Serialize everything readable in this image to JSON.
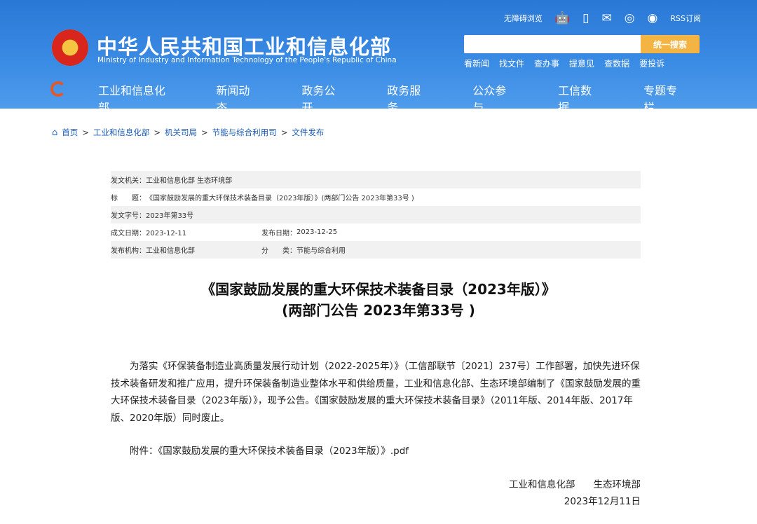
{
  "header": {
    "site_name_cn": "中华人民共和国工业和信息化部",
    "site_name_en": "Ministry of Industry and Information Technology of the People's Republic of China",
    "accessibility": "无障碍浏览",
    "rss": "RSS订阅",
    "search_button": "统一搜索",
    "search_placeholder": "",
    "quick_links": [
      "看新闻",
      "找文件",
      "查办事",
      "提意见",
      "查数据",
      "要投诉"
    ],
    "nav": [
      "工业和信息化部",
      "新闻动态",
      "政务公开",
      "政务服务",
      "公众参与",
      "工信数据",
      "专题专栏"
    ]
  },
  "breadcrumb": [
    "首页",
    "工业和信息化部",
    "机关司局",
    "节能与综合利用司",
    "文件发布"
  ],
  "meta": {
    "issuer_label": "发文机关：",
    "issuer": "工业和信息化部 生态环境部",
    "title_label": "标　　题：",
    "title": "《国家鼓励发展的重大环保技术装备目录（2023年版）》(两部门公告 2023年第33号 )",
    "number_label": "发文字号：",
    "number": "2023年第33号",
    "written_label": "成文日期：",
    "written": "2023-12-11",
    "published_label": "发布日期：",
    "published": "2023-12-25",
    "org_label": "发布机构：",
    "org": "工业和信息化部",
    "category_label": "分　　类：",
    "category": "节能与综合利用"
  },
  "doc": {
    "title_line1": "《国家鼓励发展的重大环保技术装备目录（2023年版）》",
    "title_line2": "(两部门公告 2023年第33号 )",
    "body": "为落实《环保装备制造业高质量发展行动计划（2022-2025年）》（工信部联节〔2021〕237号）工作部署，加快先进环保技术装备研发和推广应用，提升环保装备制造业整体水平和供给质量，工业和信息化部、生态环境部编制了《国家鼓励发展的重大环保技术装备目录（2023年版）》，现予公告。《国家鼓励发展的重大环保技术装备目录》（2011年版、2014年版、2017年版、2020年版）同时废止。",
    "attachment": "附件：《国家鼓励发展的重大环保技术装备目录（2023年版）》.pdf",
    "sign_org1": "工业和信息化部",
    "sign_org2": "生态环境部",
    "sign_date": "2023年12月11日"
  }
}
